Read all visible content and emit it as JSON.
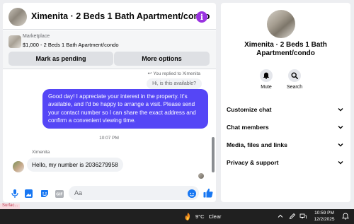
{
  "chat": {
    "title": "Ximenita · 2 Beds 1 Bath Apartment/condo",
    "listing": {
      "label": "Marketplace",
      "summary": "$1,000 - 2 Beds 1 Bath Apartment/condo",
      "mark_pending_label": "Mark as pending",
      "more_options_label": "More options"
    },
    "reply_note": "You replied to Ximenita",
    "quoted_message": "Hi, is this available?",
    "sent_message": "Good day! I appreciate your interest in the property. It's available, and I'd be happy to arrange a visit. Please send your contact number so I can share the exact address and confirm a convenient viewing time.",
    "timestamp": "10:07 PM",
    "sender_name": "Ximenita",
    "received_message": "Hello, my number is 2036279958",
    "composer": {
      "placeholder": "Aa"
    }
  },
  "details": {
    "title": "Ximenita · 2 Beds 1 Bath Apartment/condo",
    "actions": [
      {
        "label": "Mute",
        "icon": "bell-icon"
      },
      {
        "label": "Search",
        "icon": "search-icon"
      }
    ],
    "sections": [
      {
        "label": "Customize chat"
      },
      {
        "label": "Chat members"
      },
      {
        "label": "Media, files and links"
      },
      {
        "label": "Privacy & support"
      }
    ]
  },
  "taskbar": {
    "surface_tag": "Surfac...",
    "weather_temp": "9°C",
    "weather_condition": "Clear",
    "time": "10:59 PM",
    "date": "12/2/2025"
  },
  "colors": {
    "accent": "#5546f6",
    "info_icon": "#9a33e0",
    "messenger_blue": "#1877f2"
  }
}
